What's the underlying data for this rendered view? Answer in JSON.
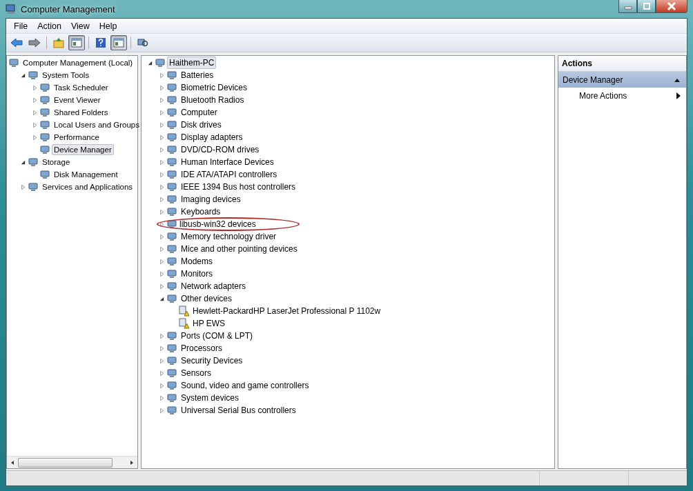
{
  "window": {
    "title": "Computer Management"
  },
  "menu": [
    "File",
    "Action",
    "View",
    "Help"
  ],
  "toolbar": [
    {
      "kind": "back",
      "pressed": false
    },
    {
      "kind": "forward",
      "pressed": false
    },
    {
      "kind": "sep"
    },
    {
      "kind": "up",
      "pressed": false
    },
    {
      "kind": "pane",
      "pressed": true
    },
    {
      "kind": "sep"
    },
    {
      "kind": "help",
      "pressed": false
    },
    {
      "kind": "pane",
      "pressed": true
    },
    {
      "kind": "sep"
    },
    {
      "kind": "scan",
      "pressed": false
    }
  ],
  "navigation_tree": [
    {
      "label": "Computer Management (Local)",
      "selected": false,
      "children": [
        {
          "label": "System Tools",
          "expanded": true,
          "selected": false,
          "children": [
            {
              "label": "Task Scheduler",
              "expanded": false,
              "selected": false
            },
            {
              "label": "Event Viewer",
              "expanded": false,
              "selected": false
            },
            {
              "label": "Shared Folders",
              "expanded": false,
              "selected": false
            },
            {
              "label": "Local Users and Groups",
              "expanded": false,
              "selected": false
            },
            {
              "label": "Performance",
              "expanded": false,
              "selected": false
            },
            {
              "label": "Device Manager",
              "selected": true
            }
          ]
        },
        {
          "label": "Storage",
          "expanded": true,
          "selected": false,
          "children": [
            {
              "label": "Disk Management",
              "selected": false
            }
          ]
        },
        {
          "label": "Services and Applications",
          "expanded": false,
          "selected": false
        }
      ]
    }
  ],
  "device_tree": [
    {
      "label": "Haithem-PC",
      "expanded": true,
      "selected": true,
      "circled": false,
      "children": [
        {
          "label": "Batteries",
          "expanded": false,
          "selected": false,
          "circled": false
        },
        {
          "label": "Biometric Devices",
          "expanded": false,
          "selected": false,
          "circled": false
        },
        {
          "label": "Bluetooth Radios",
          "expanded": false,
          "selected": false,
          "circled": false
        },
        {
          "label": "Computer",
          "expanded": false,
          "selected": false,
          "circled": false
        },
        {
          "label": "Disk drives",
          "expanded": false,
          "selected": false,
          "circled": false
        },
        {
          "label": "Display adapters",
          "expanded": false,
          "selected": false,
          "circled": false
        },
        {
          "label": "DVD/CD-ROM drives",
          "expanded": false,
          "selected": false,
          "circled": false
        },
        {
          "label": "Human Interface Devices",
          "expanded": false,
          "selected": false,
          "circled": false
        },
        {
          "label": "IDE ATA/ATAPI controllers",
          "expanded": false,
          "selected": false,
          "circled": false
        },
        {
          "label": "IEEE 1394 Bus host controllers",
          "expanded": false,
          "selected": false,
          "circled": false
        },
        {
          "label": "Imaging devices",
          "expanded": false,
          "selected": false,
          "circled": false
        },
        {
          "label": "Keyboards",
          "expanded": false,
          "selected": false,
          "circled": false
        },
        {
          "label": "libusb-win32 devices",
          "expanded": false,
          "selected": false,
          "circled": true
        },
        {
          "label": "Memory technology driver",
          "expanded": false,
          "selected": false,
          "circled": false
        },
        {
          "label": "Mice and other pointing devices",
          "expanded": false,
          "selected": false,
          "circled": false
        },
        {
          "label": "Modems",
          "expanded": false,
          "selected": false,
          "circled": false
        },
        {
          "label": "Monitors",
          "expanded": false,
          "selected": false,
          "circled": false
        },
        {
          "label": "Network adapters",
          "expanded": false,
          "selected": false,
          "circled": false
        },
        {
          "label": "Other devices",
          "expanded": true,
          "selected": false,
          "circled": false,
          "children": [
            {
              "label": "Hewlett-PackardHP LaserJet Professional P 1102w",
              "kind": "warning",
              "selected": false,
              "circled": false
            },
            {
              "label": "HP EWS",
              "kind": "warning",
              "selected": false,
              "circled": false
            }
          ]
        },
        {
          "label": "Ports (COM & LPT)",
          "expanded": false,
          "selected": false,
          "circled": false
        },
        {
          "label": "Processors",
          "expanded": false,
          "selected": false,
          "circled": false
        },
        {
          "label": "Security Devices",
          "expanded": false,
          "selected": false,
          "circled": false
        },
        {
          "label": "Sensors",
          "expanded": false,
          "selected": false,
          "circled": false
        },
        {
          "label": "Sound, video and game controllers",
          "expanded": false,
          "selected": false,
          "circled": false
        },
        {
          "label": "System devices",
          "expanded": false,
          "selected": false,
          "circled": false
        },
        {
          "label": "Universal Serial Bus controllers",
          "expanded": false,
          "selected": false,
          "circled": false
        }
      ]
    }
  ],
  "actions": {
    "title": "Actions",
    "section": {
      "label": "Device Manager",
      "expanded": true
    },
    "items": [
      "More Actions"
    ]
  }
}
